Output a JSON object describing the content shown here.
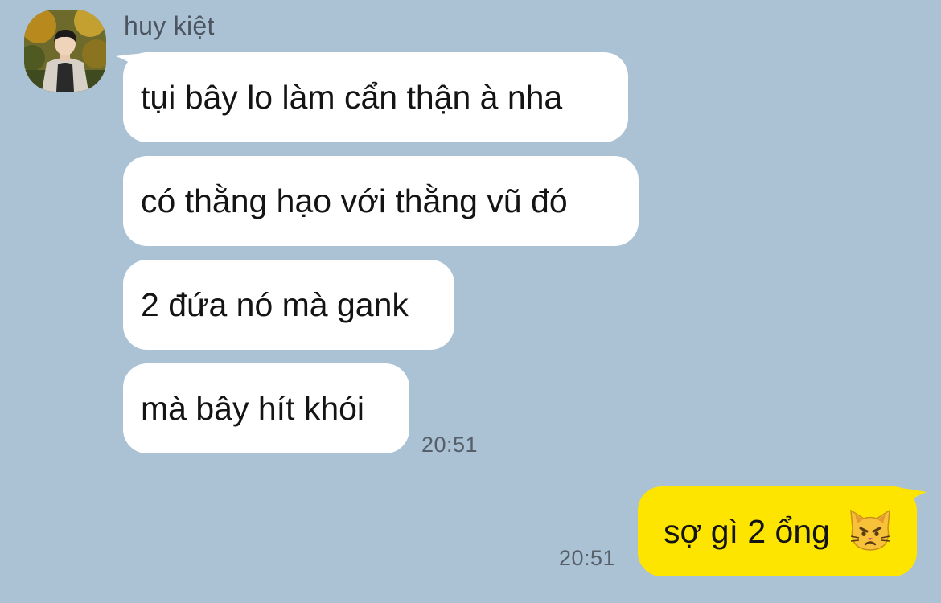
{
  "chat": {
    "incoming": {
      "sender_name": "huy kiệt",
      "messages": [
        "tụi bây lo làm cẩn thận à nha",
        "có thằng hạo với thằng vũ đó",
        "2 đứa nó mà gank",
        "mà bây hít khói"
      ],
      "time": "20:51"
    },
    "outgoing": {
      "message": "sợ gì 2 ổng",
      "emoji": "pouting-cat-icon",
      "time": "20:51"
    }
  },
  "colors": {
    "background": "#abc1d4",
    "incoming_bubble": "#ffffff",
    "outgoing_bubble": "#fee500"
  }
}
